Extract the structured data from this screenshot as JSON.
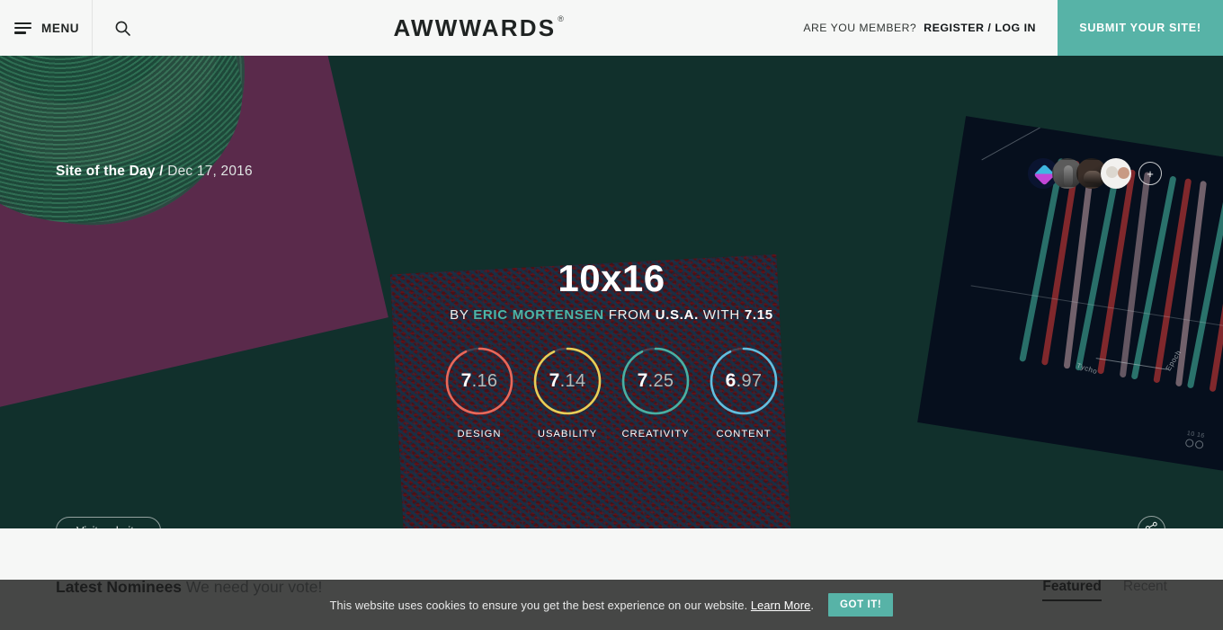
{
  "header": {
    "menu_label": "MENU",
    "menu_icon": "hamburger-icon",
    "search_icon": "search-icon",
    "logo": "AWWWARDS",
    "logo_mark": "®",
    "member_question": "ARE YOU MEMBER?",
    "member_link": "REGISTER / LOG IN",
    "submit_label": "SUBMIT YOUR SITE!",
    "submit_color": "#57b3a7"
  },
  "hero": {
    "background_color": "#11302c",
    "award_label": "Site of the Day",
    "award_separator": "/",
    "award_date": "Dec 17, 2016",
    "site_title": "10x16",
    "meta_by": "BY",
    "meta_author": "ERIC MORTENSEN",
    "meta_from": "FROM",
    "meta_country": "U.S.A.",
    "meta_with": "WITH",
    "meta_score": "7.15",
    "author_color": "#4fb5a6",
    "visit_label": "Visit website",
    "share_icon": "share-icon",
    "avatars_more": "+",
    "avatars": [
      {
        "name": "avatar-1"
      },
      {
        "name": "avatar-2"
      },
      {
        "name": "avatar-3"
      },
      {
        "name": "avatar-4"
      }
    ]
  },
  "scores": [
    {
      "label": "DESIGN",
      "whole": "7",
      "decimal": ".16",
      "value": 7.16,
      "color": "#e8685a"
    },
    {
      "label": "USABILITY",
      "whole": "7",
      "decimal": ".14",
      "value": 7.14,
      "color": "#e8ce57"
    },
    {
      "label": "CREATIVITY",
      "whole": "7",
      "decimal": ".25",
      "value": 7.25,
      "color": "#49b0a2"
    },
    {
      "label": "CONTENT",
      "whole": "6",
      "decimal": ".97",
      "value": 6.97,
      "color": "#63bede"
    }
  ],
  "nominees": {
    "title": "Latest Nominees",
    "subtitle": "We need your vote!",
    "tabs": [
      {
        "label": "Featured",
        "active": true
      },
      {
        "label": "Recent",
        "active": false
      }
    ]
  },
  "cookie": {
    "message": "This website uses cookies to ensure you get the best experience on our website.",
    "link": "Learn More",
    "period": ".",
    "button": "GOT IT!",
    "button_color": "#57b3a7"
  },
  "card_right": {
    "label_left": "Tycho",
    "label_right": "Epoch",
    "logo_text": "10 16"
  }
}
